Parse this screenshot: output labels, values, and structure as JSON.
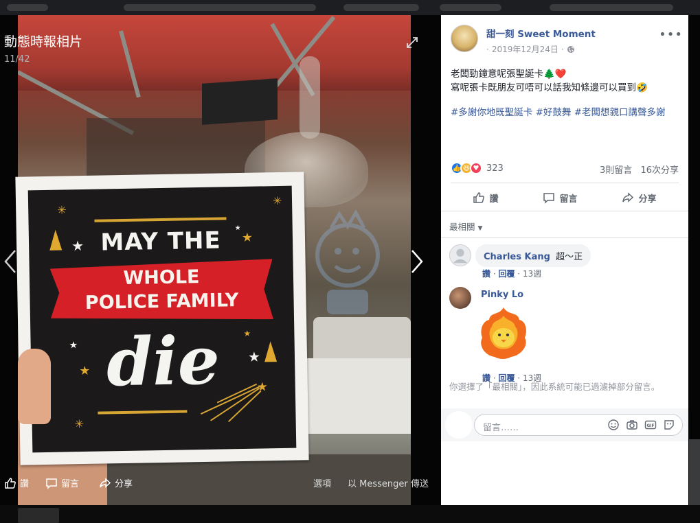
{
  "viewer": {
    "title": "動態時報相片",
    "count": "11/42"
  },
  "photo": {
    "card_line1": "MAY THE",
    "banner_line1": "WHOLE",
    "banner_line2": "POLICE FAMILY",
    "card_die": "die"
  },
  "bottom_bar": {
    "like": "讚",
    "comment": "留言",
    "share": "分享",
    "options": "選項",
    "messenger": "以 Messenger 傳送"
  },
  "post": {
    "page_name": "甜一刻 Sweet Moment",
    "date": "2019年12月24日",
    "text_line1": "老闆勁鐘意呢張聖誕卡🌲❤️",
    "text_line2": "寫呢張卡既朋友可唔可以話我知條邊可以買到🤣",
    "tags_line": "#多謝你地既聖誕卡 #好鼓舞 #老闆想親口講聲多謝",
    "reaction_count": "323",
    "comment_count": "3則留言",
    "share_count": "16次分享"
  },
  "actions": {
    "like": "讚",
    "comment": "留言",
    "share": "分享"
  },
  "sort_label": "最相關",
  "comments": [
    {
      "name": "Charles Kang",
      "text": "超～正",
      "like": "讚",
      "reply": "回覆",
      "time": "13週"
    },
    {
      "name": "Pinky Lo",
      "text": "",
      "like": "讚",
      "reply": "回覆",
      "time": "13週"
    }
  ],
  "filter_notice": "你選擇了「最相關」，因此系統可能已過濾掉部分留言。",
  "composer": {
    "placeholder": "留言……"
  },
  "colors": {
    "link": "#385898",
    "like_blue": "#1877f2",
    "card_red": "#d62028",
    "card_gold": "#d6a533"
  }
}
